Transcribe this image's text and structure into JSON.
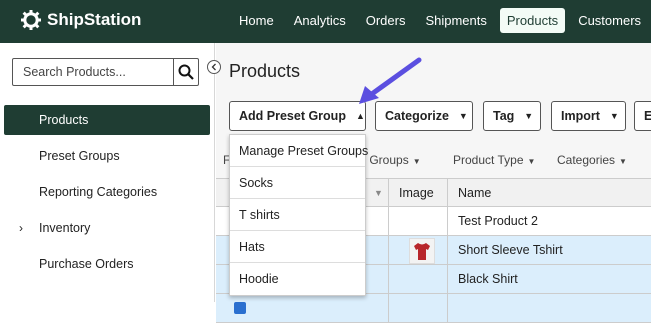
{
  "brand": {
    "name": "ShipStation"
  },
  "nav": {
    "items": [
      {
        "label": "Home"
      },
      {
        "label": "Analytics"
      },
      {
        "label": "Orders"
      },
      {
        "label": "Shipments"
      },
      {
        "label": "Products",
        "active": true
      },
      {
        "label": "Customers"
      }
    ]
  },
  "sidebar": {
    "search_placeholder": "Search Products...",
    "items": [
      {
        "label": "Products",
        "active": true
      },
      {
        "label": "Preset Groups"
      },
      {
        "label": "Reporting Categories"
      },
      {
        "label": "Inventory",
        "expandable": true
      },
      {
        "label": "Purchase Orders"
      }
    ]
  },
  "main": {
    "title": "Products",
    "toolbar": {
      "add_preset_group": "Add Preset Group",
      "categorize": "Categorize",
      "tag": "Tag",
      "import": "Import",
      "export_partial": "E"
    },
    "filters": {
      "first_partial": "F",
      "preset_groups": "et Groups",
      "product_type": "Product Type",
      "categories": "Categories"
    },
    "table": {
      "headers": {
        "image": "Image",
        "name": "Name"
      },
      "rows": [
        {
          "name": "Test Product 2",
          "selected": false,
          "has_image": false
        },
        {
          "name": "Short Sleeve Tshirt",
          "selected": true,
          "has_image": true
        },
        {
          "name": "Black Shirt",
          "selected": true,
          "has_image": false
        }
      ]
    },
    "dropdown": {
      "items": [
        {
          "label": "Manage Preset Groups"
        },
        {
          "label": "Socks"
        },
        {
          "label": "T shirts"
        },
        {
          "label": "Hats"
        },
        {
          "label": "Hoodie"
        }
      ]
    }
  },
  "colors": {
    "topbar": "#1f3d33",
    "active_nav_bg": "#f3fbf6",
    "selected_row": "#dbeefc",
    "annotation_arrow": "#5b4fe0"
  }
}
